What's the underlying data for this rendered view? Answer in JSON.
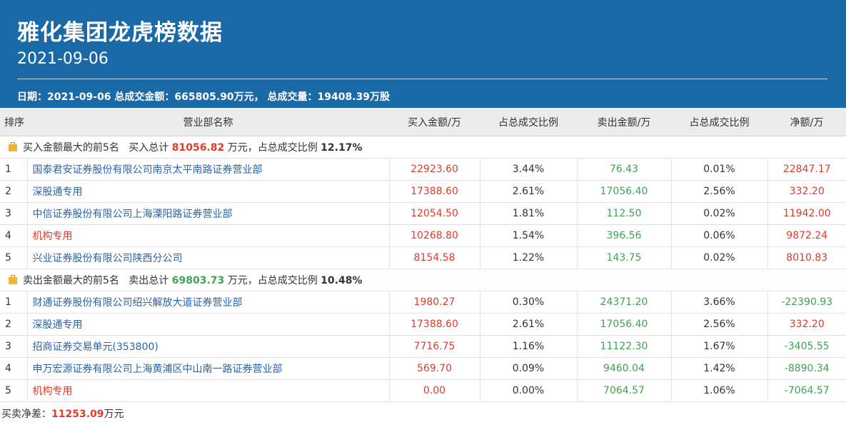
{
  "header": {
    "title": "雅化集团龙虎榜数据",
    "date": "2021-09-06",
    "summary": "日期：2021-09-06 总成交金额：665805.90万元， 总成交量：19408.39万股"
  },
  "columns": [
    "排序",
    "营业部名称",
    "买入金额/万",
    "占总成交比例",
    "卖出金额/万",
    "占总成交比例",
    "净额/万"
  ],
  "buy_group": {
    "label": "买入金额最大的前5名",
    "total_label": "买入总计",
    "total": "81056.82",
    "unit_text": "万元，占总成交比例",
    "ratio": "12.17%"
  },
  "buy_rows": [
    {
      "rank": "1",
      "name": "国泰君安证券股份有限公司南京太平南路证券营业部",
      "name_color": "blue",
      "buy": "22923.60",
      "buy_ratio": "3.44%",
      "sell": "76.43",
      "sell_ratio": "0.01%",
      "net": "22847.17",
      "net_color": "red"
    },
    {
      "rank": "2",
      "name": "深股通专用",
      "name_color": "blue",
      "buy": "17388.60",
      "buy_ratio": "2.61%",
      "sell": "17056.40",
      "sell_ratio": "2.56%",
      "net": "332.20",
      "net_color": "red"
    },
    {
      "rank": "3",
      "name": "中信证券股份有限公司上海溧阳路证券营业部",
      "name_color": "blue",
      "buy": "12054.50",
      "buy_ratio": "1.81%",
      "sell": "112.50",
      "sell_ratio": "0.02%",
      "net": "11942.00",
      "net_color": "red"
    },
    {
      "rank": "4",
      "name": "机构专用",
      "name_color": "red",
      "buy": "10268.80",
      "buy_ratio": "1.54%",
      "sell": "396.56",
      "sell_ratio": "0.06%",
      "net": "9872.24",
      "net_color": "red"
    },
    {
      "rank": "5",
      "name": "兴业证券股份有限公司陕西分公司",
      "name_color": "blue",
      "buy": "8154.58",
      "buy_ratio": "1.22%",
      "sell": "143.75",
      "sell_ratio": "0.02%",
      "net": "8010.83",
      "net_color": "red"
    }
  ],
  "sell_group": {
    "label": "卖出金额最大的前5名",
    "total_label": "卖出总计",
    "total": "69803.73",
    "unit_text": "万元，占总成交比例",
    "ratio": "10.48%"
  },
  "sell_rows": [
    {
      "rank": "1",
      "name": "财通证券股份有限公司绍兴解放大道证券营业部",
      "name_color": "blue",
      "buy": "1980.27",
      "buy_ratio": "0.30%",
      "sell": "24371.20",
      "sell_ratio": "3.66%",
      "net": "-22390.93",
      "net_color": "green"
    },
    {
      "rank": "2",
      "name": "深股通专用",
      "name_color": "blue",
      "buy": "17388.60",
      "buy_ratio": "2.61%",
      "sell": "17056.40",
      "sell_ratio": "2.56%",
      "net": "332.20",
      "net_color": "red"
    },
    {
      "rank": "3",
      "name": "招商证券交易单元(353800)",
      "name_color": "blue",
      "buy": "7716.75",
      "buy_ratio": "1.16%",
      "sell": "11122.30",
      "sell_ratio": "1.67%",
      "net": "-3405.55",
      "net_color": "green"
    },
    {
      "rank": "4",
      "name": "申万宏源证券有限公司上海黄浦区中山南一路证券营业部",
      "name_color": "blue",
      "buy": "569.70",
      "buy_ratio": "0.09%",
      "sell": "9460.04",
      "sell_ratio": "1.42%",
      "net": "-8890.34",
      "net_color": "green"
    },
    {
      "rank": "5",
      "name": "机构专用",
      "name_color": "red",
      "buy": "0.00",
      "buy_ratio": "0.00%",
      "sell": "7064.57",
      "sell_ratio": "1.06%",
      "net": "-7064.57",
      "net_color": "green"
    }
  ],
  "footer": {
    "label": "买卖净差：",
    "value": "11253.09",
    "unit": "万元"
  },
  "colors": {
    "header_bg": "#1b6aa8",
    "buy_red": "#e03b2b",
    "sell_green": "#3ea354",
    "link_blue": "#2a63a8"
  }
}
